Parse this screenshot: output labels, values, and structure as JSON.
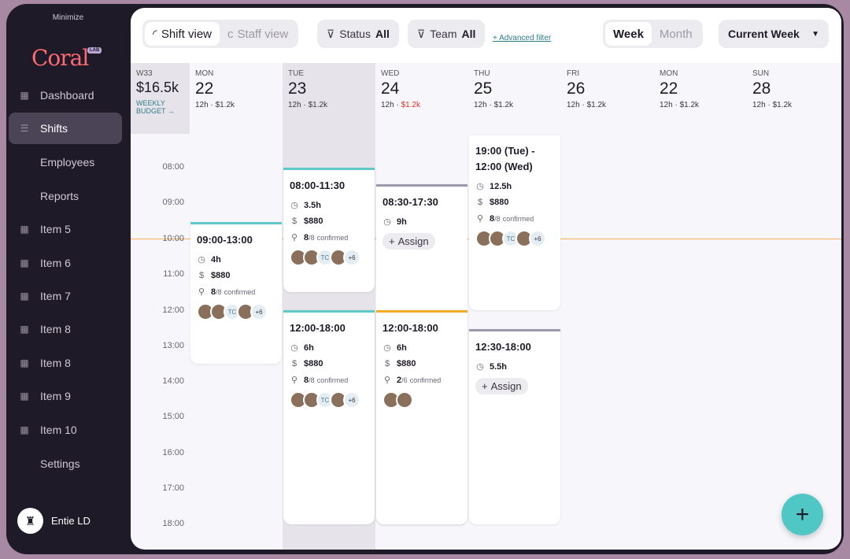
{
  "sidebar": {
    "minimize": "Minimize",
    "logo": "Coral",
    "logo_tag": "LAB",
    "items": [
      {
        "label": "Dashboard",
        "icon": "grid-icon"
      },
      {
        "label": "Shifts",
        "icon": "shifts-icon",
        "active": true
      },
      {
        "label": "Employees",
        "icon": ""
      },
      {
        "label": "Reports",
        "icon": ""
      },
      {
        "label": "Item 5",
        "icon": "grid-icon"
      },
      {
        "label": "Item 6",
        "icon": "grid-icon"
      },
      {
        "label": "Item 7",
        "icon": "grid-icon"
      },
      {
        "label": "Item 8",
        "icon": "grid-icon"
      },
      {
        "label": "Item 8",
        "icon": "grid-icon"
      },
      {
        "label": "Item 9",
        "icon": "grid-icon"
      },
      {
        "label": "Item 10",
        "icon": "grid-icon"
      },
      {
        "label": "Settings",
        "icon": ""
      }
    ],
    "user": "Entie LD"
  },
  "toolbar": {
    "shift_view": "Shift view",
    "staff_view": "Staff view",
    "status_label": "Status",
    "status_value": "All",
    "team_label": "Team",
    "team_value": "All",
    "advanced": "+ Advanced filter",
    "week": "Week",
    "month": "Month",
    "period": "Current Week"
  },
  "summary": {
    "week": "W33",
    "budget": "$16.5k",
    "budget_label": "WEEKLY BUDGET →"
  },
  "days": [
    {
      "dow": "MON",
      "date": "22",
      "hours": "12h",
      "cost": "$1.2k",
      "over": false
    },
    {
      "dow": "TUE",
      "date": "23",
      "hours": "12h",
      "cost": "$1.2k",
      "over": false
    },
    {
      "dow": "WED",
      "date": "24",
      "hours": "12h",
      "cost": "$1.2k",
      "over": true
    },
    {
      "dow": "THU",
      "date": "25",
      "hours": "12h",
      "cost": "$1.2k",
      "over": false
    },
    {
      "dow": "FRI",
      "date": "26",
      "hours": "12h",
      "cost": "$1.2k",
      "over": false
    },
    {
      "dow": "MON",
      "date": "22",
      "hours": "12h",
      "cost": "$1.2k",
      "over": false
    },
    {
      "dow": "SUN",
      "date": "28",
      "hours": "12h",
      "cost": "$1.2k",
      "over": false
    }
  ],
  "hours": [
    "08:00",
    "09:00",
    "10:00",
    "11:00",
    "12:00",
    "13:00",
    "14:00",
    "15:00",
    "16:00",
    "17:00",
    "18:00"
  ],
  "shifts": [
    {
      "time": "09:00-13:00",
      "duration": "4h",
      "cost": "$880",
      "confirmed": "8",
      "total": "/8",
      "conf_label": "confirmed",
      "more": "+6"
    },
    {
      "time": "08:00-11:30",
      "duration": "3.5h",
      "cost": "$880",
      "confirmed": "8",
      "total": "/8",
      "conf_label": "confirmed",
      "more": "+6"
    },
    {
      "time": "12:00-18:00",
      "duration": "6h",
      "cost": "$880",
      "confirmed": "8",
      "total": "/8",
      "conf_label": "confirmed",
      "more": "+6"
    },
    {
      "time": "08:30-17:30",
      "duration": "9h",
      "assign": "Assign"
    },
    {
      "time": "12:00-18:00",
      "duration": "6h",
      "cost": "$880",
      "confirmed": "2",
      "total": "/6",
      "conf_label": "confirmed"
    },
    {
      "time": "19:00 (Tue) - 12:00 (Wed)",
      "duration": "12.5h",
      "cost": "$880",
      "confirmed": "8",
      "total": "/8",
      "conf_label": "confirmed",
      "more": "+6"
    },
    {
      "time": "12:30-18:00",
      "duration": "5.5h",
      "assign": "Assign"
    }
  ],
  "avatar_initials": "TC",
  "colors": {
    "accent": "#4fc7c4",
    "brand": "#ff6a72",
    "now_line": "#f4b15a",
    "sidebar": "#1f1a27"
  }
}
